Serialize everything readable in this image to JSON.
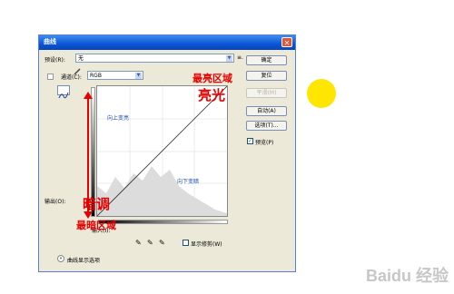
{
  "dialog": {
    "title": "曲线",
    "preset_label": "预设(R):",
    "preset_value": "无",
    "preset_menu_icon": "list-menu-icon",
    "channel_label": "通道(C):",
    "channel_value": "RGB",
    "output_label": "输出(O):",
    "input_label": "输入(I):",
    "show_clipping_label": "显示修剪(W)",
    "curve_display_options_label": "曲线显示选项",
    "buttons": {
      "ok": "确定",
      "reset": "复位",
      "smooth": "平滑(M)",
      "auto": "自动(A)",
      "options": "选项(T)...",
      "preview": "预览(P)"
    }
  },
  "annotations": {
    "brightest_area": "最亮区域",
    "highlights": "亮光",
    "shadows": "暗调",
    "darkest_area": "最暗区域",
    "upward_brighten": "向上变亮",
    "downward_darken": "向下变暗"
  },
  "colors": {
    "annotation_red": "#e60000",
    "yellow_marker": "#ffe600",
    "title_blue": "#0a55d6"
  },
  "watermark": "Baidu 经验"
}
